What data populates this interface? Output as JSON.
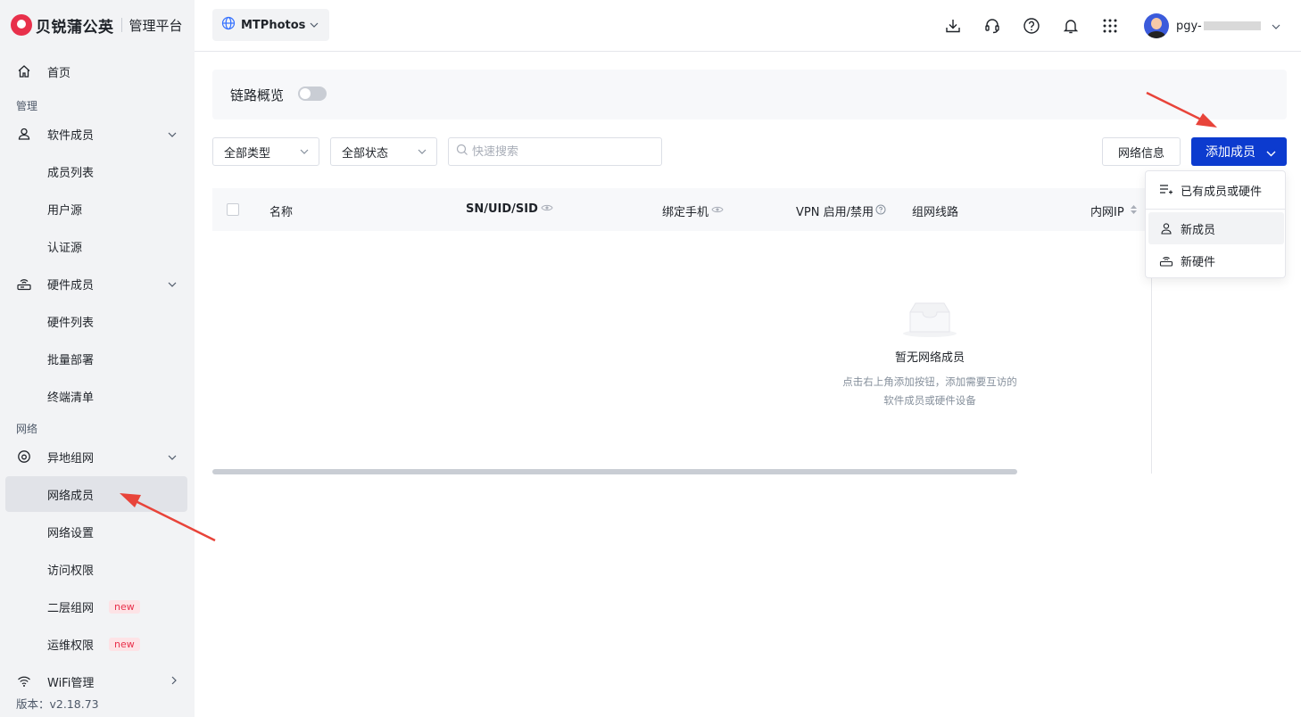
{
  "brand": {
    "name": "贝锐蒲公英",
    "subtitle": "管理平台"
  },
  "sidebar": {
    "home": "首页",
    "section_manage": "管理",
    "software_members": "软件成员",
    "member_list": "成员列表",
    "user_source": "用户源",
    "auth_source": "认证源",
    "hardware_members": "硬件成员",
    "hardware_list": "硬件列表",
    "batch_deploy": "批量部署",
    "terminal_list": "终端清单",
    "section_network": "网络",
    "remote_network": "异地组网",
    "network_members": "网络成员",
    "network_settings": "网络设置",
    "access_rights": "访问权限",
    "layer2_network": "二层组网",
    "ops_rights": "运维权限",
    "new_badge": "new",
    "wifi_manage": "WiFi管理",
    "version": "版本：v2.18.73"
  },
  "topbar": {
    "network_name": "MTPhotos",
    "user_name": "pgy-"
  },
  "overview": {
    "label": "链路概览",
    "enabled": false
  },
  "filters": {
    "type": "全部类型",
    "status": "全部状态",
    "search_placeholder": "快速搜索"
  },
  "buttons": {
    "network_info": "网络信息",
    "add_member": "添加成员"
  },
  "table": {
    "columns": [
      "名称",
      "SN/UID/SID",
      "绑定手机",
      "VPN 启用/禁用",
      "组网线路",
      "内网IP"
    ]
  },
  "empty": {
    "title": "暂无网络成员",
    "desc_line1": "点击右上角添加按钮，添加需要互访的",
    "desc_line2": "软件成员或硬件设备"
  },
  "dropdown": {
    "existing": "已有成员或硬件",
    "new_member": "新成员",
    "new_hardware": "新硬件"
  },
  "colors": {
    "primary": "#0c3bcf",
    "brand": "#e8304b",
    "annotation": "#e8443a"
  }
}
